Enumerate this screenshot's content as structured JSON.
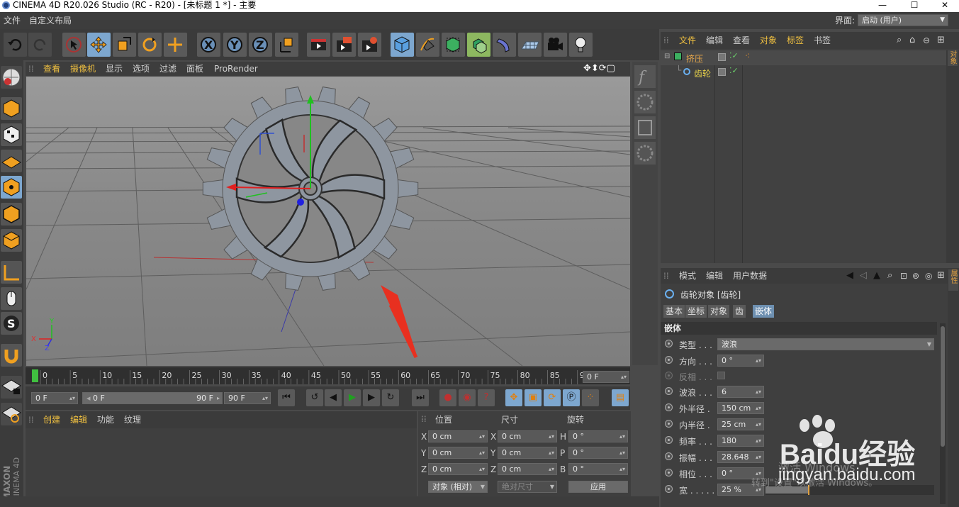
{
  "window": {
    "title": "CINEMA 4D R20.026 Studio (RC - R20) - [未标题 1 *] - 主要",
    "minimize": "—",
    "maximize": "☐",
    "close": "✕"
  },
  "menubar": {
    "items": [
      "文件",
      "自定义布局"
    ],
    "interface_label": "界面:",
    "interface_value": "启动 (用户)"
  },
  "viewport": {
    "menu": [
      "查看",
      "摄像机",
      "显示",
      "选项",
      "过滤",
      "面板",
      "ProRender"
    ],
    "axis_labels": [
      "Y",
      "Z",
      "X"
    ]
  },
  "timeline": {
    "ticks": [
      "0",
      "5",
      "10",
      "15",
      "20",
      "25",
      "30",
      "35",
      "40",
      "45",
      "50",
      "55",
      "60",
      "65",
      "70",
      "75",
      "80",
      "85",
      "90"
    ],
    "current_frame": "0 F"
  },
  "transport": {
    "start_frame": "0 F",
    "range_start": "0 F",
    "range_end": "90 F",
    "end_frame": "90 F"
  },
  "material_panel": {
    "menu": [
      "创建",
      "编辑",
      "功能",
      "纹理"
    ]
  },
  "coord_panel": {
    "headers": [
      "位置",
      "尺寸",
      "旋转"
    ],
    "pos_axes": [
      "X",
      "Y",
      "Z"
    ],
    "pos_values": [
      "0 cm",
      "0 cm",
      "0 cm"
    ],
    "size_axes": [
      "X",
      "Y",
      "Z"
    ],
    "size_values": [
      "0 cm",
      "0 cm",
      "0 cm"
    ],
    "rot_axes": [
      "H",
      "P",
      "B"
    ],
    "rot_values": [
      "0 °",
      "0 °",
      "0 °"
    ],
    "mode": "对象 (相对)",
    "size_mode": "绝对尺寸",
    "apply": "应用"
  },
  "object_manager": {
    "menu": [
      "文件",
      "编辑",
      "查看",
      "对象",
      "标签",
      "书签"
    ],
    "objects": [
      {
        "name": "挤压",
        "color": "#e8a84a"
      },
      {
        "name": "齿轮",
        "color": "#e8d24a"
      }
    ]
  },
  "attribute_manager": {
    "menu": [
      "模式",
      "编辑",
      "用户数据"
    ],
    "title": "齿轮对象 [齿轮]",
    "tabs": [
      "基本",
      "坐标",
      "对象",
      "齿",
      "嵌体"
    ],
    "selected_tab": "嵌体",
    "section": "嵌体",
    "props": [
      {
        "label": "类型 . . .",
        "value": "波浪"
      },
      {
        "label": "方向 . . .",
        "value": "0 °"
      },
      {
        "label": "反相 . . .",
        "value": ""
      },
      {
        "label": "波浪 . . .",
        "value": "6"
      },
      {
        "label": "外半径 .",
        "value": "150 cm"
      },
      {
        "label": "内半径 .",
        "value": "25 cm"
      },
      {
        "label": "频率 . . .",
        "value": "180"
      },
      {
        "label": "振幅 . . .",
        "value": "28.648"
      },
      {
        "label": "相位 . . .",
        "value": "0 °"
      },
      {
        "label": "宽 . . . . .",
        "value": "25 %"
      }
    ]
  },
  "side_tabs": {
    "right_top": "对象",
    "right_bottom": "属性"
  },
  "branding": {
    "logo": "MAXON CINEMA 4D"
  },
  "watermarks": {
    "baidu": "Baidu经验",
    "baidu_url": "jingyan.baidu.com",
    "windows1": "激活 Windows",
    "windows2": "转到\"设置\"以激活 Windows。"
  },
  "colors": {
    "accent_blue": "#7da7cf",
    "menu_highlight": "#f0c040",
    "viewport_bg": "#878787"
  }
}
